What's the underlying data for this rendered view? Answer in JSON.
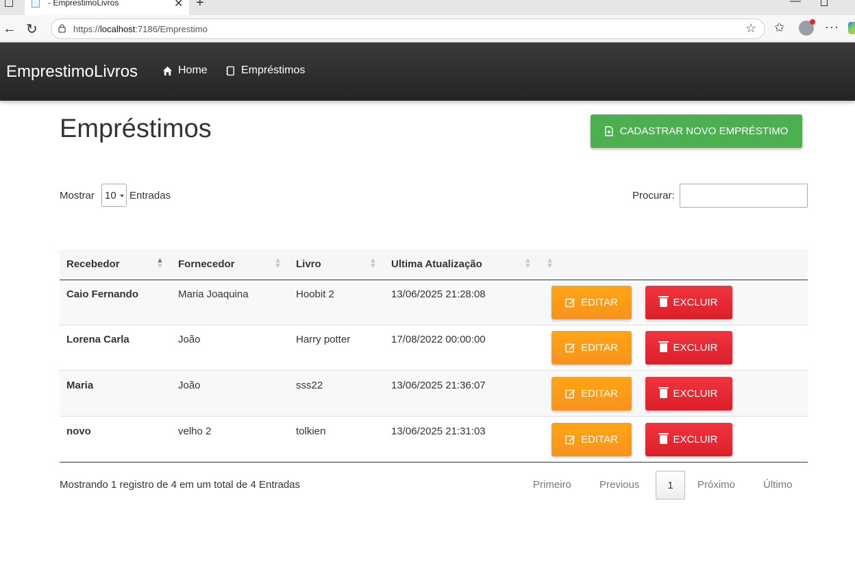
{
  "browser": {
    "tab_title": "- EmprestimoLivros",
    "url_prefix": "https://",
    "url_host": "localhost",
    "url_rest": ":7186/Emprestimo"
  },
  "navbar": {
    "brand": "EmprestimoLivros",
    "links": [
      {
        "label": "Home",
        "icon": "home-icon"
      },
      {
        "label": "Empréstimos",
        "icon": "book-icon"
      }
    ]
  },
  "page": {
    "title": "Empréstimos",
    "new_button": "CADASTRAR NOVO EMPRÉSTIMO"
  },
  "length_control": {
    "prefix": "Mostrar",
    "value": "10",
    "suffix": "Entradas"
  },
  "search": {
    "label": "Procurar:",
    "value": ""
  },
  "table": {
    "columns": [
      "Recebedor",
      "Fornecedor",
      "Livro",
      "Ultima Atualização",
      ""
    ],
    "rows": [
      {
        "recebedor": "Caio Fernando",
        "fornecedor": "Maria Joaquina",
        "livro": "Hoobit 2",
        "atualizacao": "13/06/2025 21:28:08"
      },
      {
        "recebedor": "Lorena Carla",
        "fornecedor": "João",
        "livro": "Harry potter",
        "atualizacao": "17/08/2022 00:00:00"
      },
      {
        "recebedor": "Maria",
        "fornecedor": "João",
        "livro": "sss22",
        "atualizacao": "13/06/2025 21:36:07"
      },
      {
        "recebedor": "novo",
        "fornecedor": "velho 2",
        "livro": "tolkien",
        "atualizacao": "13/06/2025 21:31:03"
      }
    ],
    "edit_label": "EDITAR",
    "delete_label": "EXCLUIR"
  },
  "footer": {
    "info": "Mostrando 1 registro de 4 em um total de 4 Entradas",
    "first": "Primeiro",
    "previous": "Previous",
    "current": "1",
    "next": "Próximo",
    "last": "Último"
  },
  "colors": {
    "navbar": "#2f2f2f",
    "new_button": "#4caf50",
    "edit_button": "#f7931e",
    "delete_button": "#dc1f29"
  }
}
